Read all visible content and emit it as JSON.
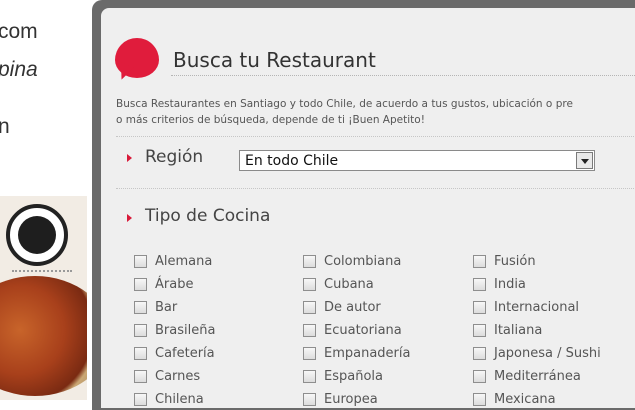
{
  "left": {
    "lines": [
      "com",
      "pina",
      "n"
    ]
  },
  "panel": {
    "title": "Busca tu Restaurant",
    "description_line1": "Busca Restaurantes en Santiago y todo Chile, de acuerdo a tus gustos, ubicación o pre",
    "description_line2": "o más criterios de búsqueda, depende de ti ¡Buen Apetito!",
    "region": {
      "label": "Región",
      "selected": "En todo Chile"
    },
    "cocina": {
      "label": "Tipo de Cocina",
      "col1": [
        "Alemana",
        "Árabe",
        "Bar",
        "Brasileña",
        "Cafetería",
        "Carnes",
        "Chilena"
      ],
      "col2": [
        "Colombiana",
        "Cubana",
        "De autor",
        "Ecuatoriana",
        "Empanadería",
        "Española",
        "Europea"
      ],
      "col3": [
        "Fusión",
        "India",
        "Internacional",
        "Italiana",
        "Japonesa / Sushi",
        "Mediterránea",
        "Mexicana"
      ]
    }
  },
  "colors": {
    "accent": "#e01c3c",
    "frame": "#6a6a6a",
    "panel_bg": "#efefef"
  }
}
